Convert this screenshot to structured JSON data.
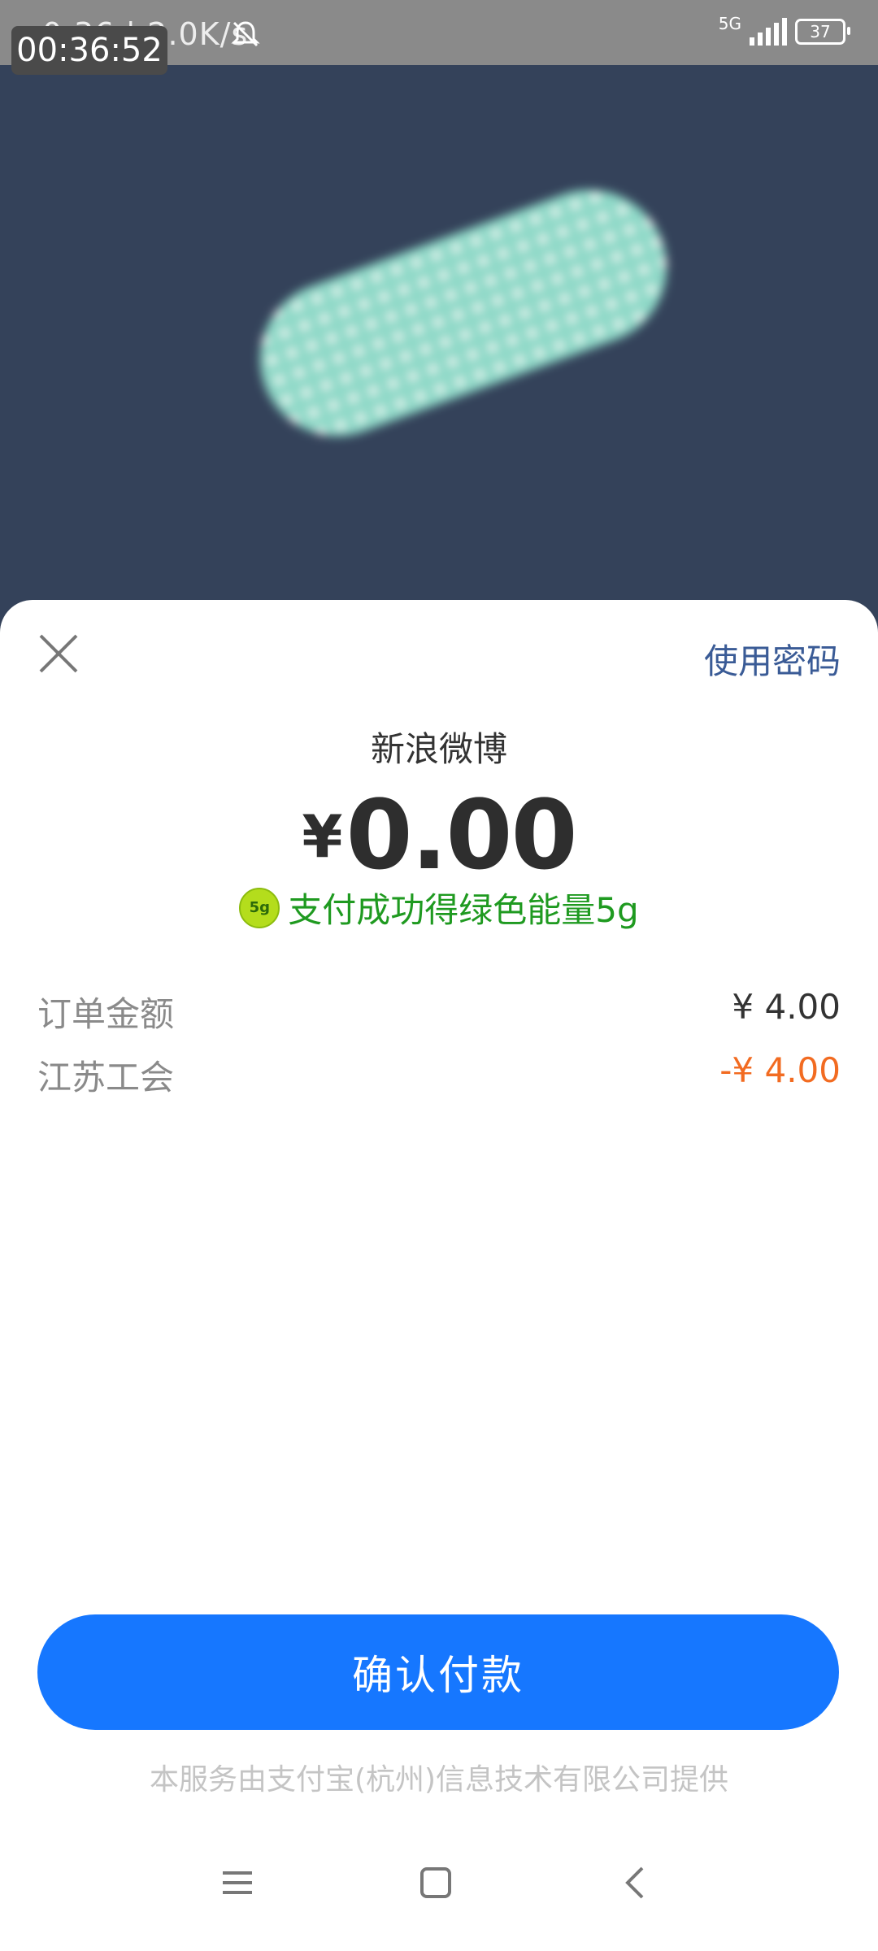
{
  "status_bar": {
    "left_text": "0:36 | 2.0K/s",
    "network": "5G",
    "battery": "37",
    "timer": "00:36:52"
  },
  "sheet": {
    "use_password": "使用密码",
    "merchant": "新浪微博",
    "currency_symbol": "¥",
    "amount": "0.00",
    "energy_badge": "5g",
    "energy_text": "支付成功得绿色能量5g",
    "rows": [
      {
        "label": "订单金额",
        "value": "¥ 4.00"
      },
      {
        "label": "江苏工会",
        "value": "-¥ 4.00"
      }
    ],
    "confirm_button": "确认付款",
    "footer_note": "本服务由支付宝(杭州)信息技术有限公司提供"
  },
  "colors": {
    "background_top": "#34425a",
    "accent_blue": "#1677ff",
    "link_blue": "#3a5b96",
    "energy_green": "#1f9a20",
    "discount_orange": "#f26b21"
  },
  "icons": [
    "bell-muted-icon",
    "signal-icon",
    "battery-icon",
    "close-icon",
    "energy-badge-icon",
    "menu-icon",
    "home-icon",
    "back-icon"
  ]
}
